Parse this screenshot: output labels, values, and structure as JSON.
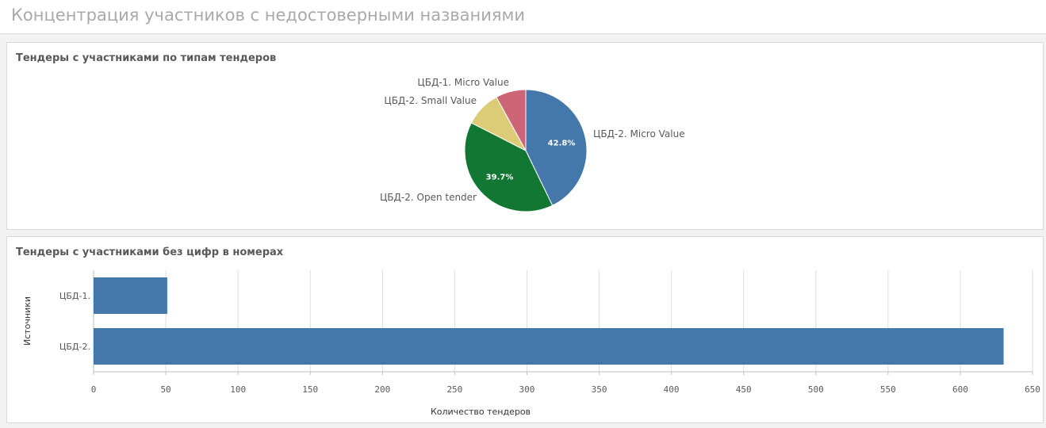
{
  "header": {
    "title": "Концентрация участников с недостоверными названиями"
  },
  "panels": {
    "pie_title": "Тендеры с участниками по типам тендеров",
    "bar_title": "Тендеры с участниками без цифр в номерах"
  },
  "chart_data": [
    {
      "type": "pie",
      "title": "Тендеры с участниками по типам тендеров",
      "slices": [
        {
          "label": "ЦБД-2. Micro Value",
          "value": 42.8,
          "pct_label": "42.8%",
          "color": "#4477aa"
        },
        {
          "label": "ЦБД-2. Open tender",
          "value": 39.7,
          "pct_label": "39.7%",
          "color": "#117733"
        },
        {
          "label": "ЦБД-2. Small Value",
          "value": 9.5,
          "pct_label": "",
          "color": "#ddcc77"
        },
        {
          "label": "ЦБД-1. Micro Value",
          "value": 8.0,
          "pct_label": "",
          "color": "#cc6677"
        }
      ]
    },
    {
      "type": "bar",
      "orientation": "horizontal",
      "title": "Тендеры с участниками без цифр в номерах",
      "categories": [
        "ЦБД-1.",
        "ЦБД-2."
      ],
      "values": [
        51,
        630
      ],
      "xlabel": "Количество тендеров",
      "ylabel": "Источники",
      "xlim": [
        0,
        650
      ],
      "xticks": [
        "0",
        "50",
        "100",
        "150",
        "200",
        "250",
        "300",
        "350",
        "400",
        "450",
        "500",
        "550",
        "600",
        "650"
      ],
      "bar_color": "#4477aa",
      "grid": true
    }
  ]
}
